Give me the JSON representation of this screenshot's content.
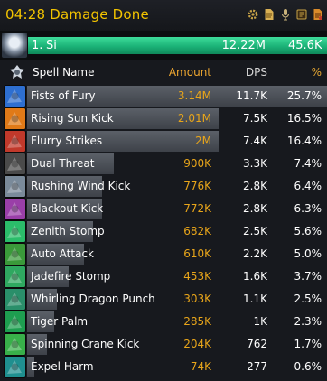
{
  "window": {
    "title": "04:28 Damage Done",
    "title_color": "#f2c300",
    "icons": [
      "gear-icon",
      "document-icon",
      "microphone-icon",
      "reset-icon",
      "report-icon"
    ]
  },
  "player": {
    "rank": "1.",
    "name": "Si",
    "amount": "12.22M",
    "dps": "45.6K",
    "bar_color": "#1fbf80",
    "icon": "player-portrait"
  },
  "columns": {
    "name": "Spell Name",
    "amount": "Amount",
    "dps": "DPS",
    "percent": "%"
  },
  "spells": [
    {
      "name": "Fists of Fury",
      "amount": "3.14M",
      "dps": "11.7K",
      "percent": "25.7%",
      "fill": 1.0,
      "icon": "fists-of-fury-icon",
      "color": "#2e6fd0"
    },
    {
      "name": "Rising Sun Kick",
      "amount": "2.01M",
      "dps": "7.5K",
      "percent": "16.5%",
      "fill": 0.64,
      "icon": "rising-sun-kick-icon",
      "color": "#e07a18"
    },
    {
      "name": "Flurry Strikes",
      "amount": "2M",
      "dps": "7.4K",
      "percent": "16.4%",
      "fill": 0.64,
      "icon": "flurry-strikes-icon",
      "color": "#c1392b"
    },
    {
      "name": "Dual Threat",
      "amount": "900K",
      "dps": "3.3K",
      "percent": "7.4%",
      "fill": 0.29,
      "icon": "dual-threat-icon",
      "color": "#4a4a4a"
    },
    {
      "name": "Rushing Wind Kick",
      "amount": "776K",
      "dps": "2.8K",
      "percent": "6.4%",
      "fill": 0.25,
      "icon": "rushing-wind-kick-icon",
      "color": "#7a8a9a"
    },
    {
      "name": "Blackout Kick",
      "amount": "772K",
      "dps": "2.8K",
      "percent": "6.3%",
      "fill": 0.25,
      "icon": "blackout-kick-icon",
      "color": "#9a3fa8"
    },
    {
      "name": "Zenith Stomp",
      "amount": "682K",
      "dps": "2.5K",
      "percent": "5.6%",
      "fill": 0.22,
      "icon": "zenith-stomp-icon",
      "color": "#2bbd6a"
    },
    {
      "name": "Auto Attack",
      "amount": "610K",
      "dps": "2.2K",
      "percent": "5.0%",
      "fill": 0.19,
      "icon": "auto-attack-icon",
      "color": "#3a9a3a"
    },
    {
      "name": "Jadefire Stomp",
      "amount": "453K",
      "dps": "1.6K",
      "percent": "3.7%",
      "fill": 0.14,
      "icon": "jadefire-stomp-icon",
      "color": "#2fa860"
    },
    {
      "name": "Whirling Dragon Punch",
      "amount": "303K",
      "dps": "1.1K",
      "percent": "2.5%",
      "fill": 0.1,
      "icon": "whirling-dragon-punch-icon",
      "color": "#2a8f6a"
    },
    {
      "name": "Tiger Palm",
      "amount": "285K",
      "dps": "1K",
      "percent": "2.3%",
      "fill": 0.09,
      "icon": "tiger-palm-icon",
      "color": "#1e9e50"
    },
    {
      "name": "Spinning Crane Kick",
      "amount": "204K",
      "dps": "762",
      "percent": "1.7%",
      "fill": 0.065,
      "icon": "spinning-crane-kick-icon",
      "color": "#38b04a"
    },
    {
      "name": "Expel Harm",
      "amount": "74K",
      "dps": "277",
      "percent": "0.6%",
      "fill": 0.024,
      "icon": "expel-harm-icon",
      "color": "#1f8f8f"
    }
  ]
}
